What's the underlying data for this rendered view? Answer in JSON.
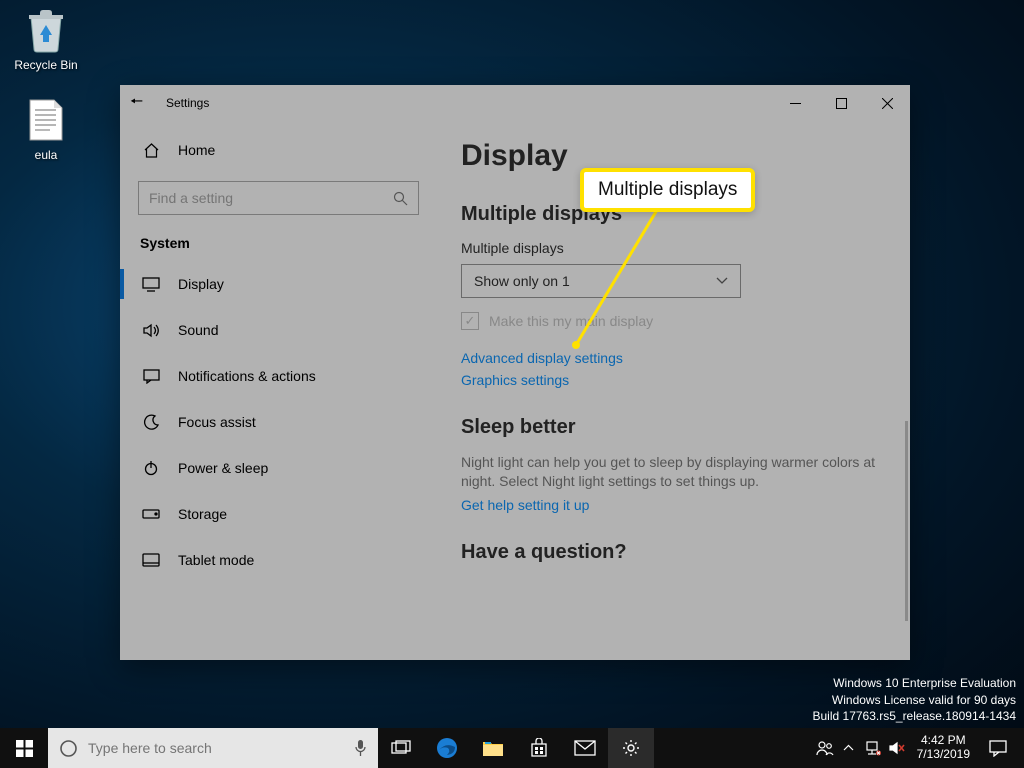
{
  "desktop": {
    "icons": [
      {
        "name": "recycle-bin",
        "label": "Recycle Bin"
      },
      {
        "name": "eula-file",
        "label": "eula"
      }
    ]
  },
  "window": {
    "title": "Settings",
    "home_label": "Home",
    "search_placeholder": "Find a setting",
    "category": "System",
    "nav": [
      {
        "icon": "display-icon",
        "label": "Display",
        "active": true
      },
      {
        "icon": "sound-icon",
        "label": "Sound"
      },
      {
        "icon": "notifications-icon",
        "label": "Notifications & actions"
      },
      {
        "icon": "focus-icon",
        "label": "Focus assist"
      },
      {
        "icon": "power-icon",
        "label": "Power & sleep"
      },
      {
        "icon": "storage-icon",
        "label": "Storage"
      },
      {
        "icon": "tablet-icon",
        "label": "Tablet mode"
      }
    ]
  },
  "content": {
    "page_title": "Display",
    "section1_title": "Multiple displays",
    "multi_label": "Multiple displays",
    "multi_value": "Show only on 1",
    "main_display_label": "Make this my main display",
    "link_advanced": "Advanced display settings",
    "link_graphics": "Graphics settings",
    "section2_title": "Sleep better",
    "sleep_para": "Night light can help you get to sleep by displaying warmer colors at night. Select Night light settings to set things up.",
    "link_sleep": "Get help setting it up",
    "section3_title": "Have a question?"
  },
  "callout": {
    "text": "Multiple displays"
  },
  "watermark": {
    "l1": "Windows 10 Enterprise Evaluation",
    "l2": "Windows License valid for 90 days",
    "l3": "Build 17763.rs5_release.180914-1434"
  },
  "taskbar": {
    "search_placeholder": "Type here to search",
    "time": "4:42 PM",
    "date": "7/13/2019"
  }
}
